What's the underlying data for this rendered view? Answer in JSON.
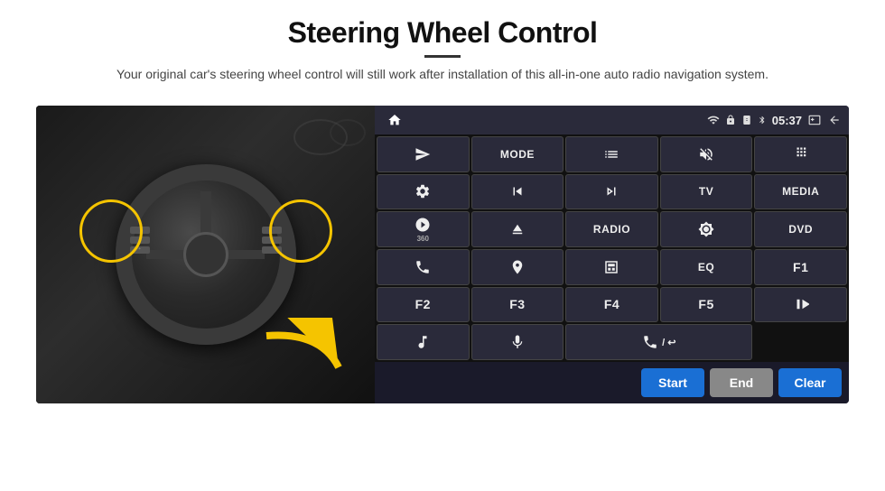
{
  "page": {
    "title": "Steering Wheel Control",
    "subtitle": "Your original car's steering wheel control will still work after installation of this all-in-one auto radio navigation system.",
    "divider": true
  },
  "panel": {
    "status_bar": {
      "time": "05:37",
      "wifi_icon": "wifi",
      "lock_icon": "lock",
      "sim_icon": "sim",
      "bt_icon": "bluetooth",
      "screen_icon": "screen",
      "back_icon": "back"
    },
    "buttons": [
      {
        "id": "b1",
        "type": "icon",
        "icon": "send",
        "label": ""
      },
      {
        "id": "b2",
        "type": "text",
        "label": "MODE"
      },
      {
        "id": "b3",
        "type": "icon",
        "icon": "list",
        "label": ""
      },
      {
        "id": "b4",
        "type": "icon",
        "icon": "mute",
        "label": ""
      },
      {
        "id": "b5",
        "type": "icon",
        "icon": "grid",
        "label": ""
      },
      {
        "id": "b6",
        "type": "icon",
        "icon": "settings",
        "label": ""
      },
      {
        "id": "b7",
        "type": "icon",
        "icon": "rewind",
        "label": ""
      },
      {
        "id": "b8",
        "type": "icon",
        "icon": "fastforward",
        "label": ""
      },
      {
        "id": "b9",
        "type": "text",
        "label": "TV"
      },
      {
        "id": "b10",
        "type": "text",
        "label": "MEDIA"
      },
      {
        "id": "b11",
        "type": "icon",
        "icon": "360cam",
        "label": ""
      },
      {
        "id": "b12",
        "type": "icon",
        "icon": "eject",
        "label": ""
      },
      {
        "id": "b13",
        "type": "text",
        "label": "RADIO"
      },
      {
        "id": "b14",
        "type": "icon",
        "icon": "brightness",
        "label": ""
      },
      {
        "id": "b15",
        "type": "text",
        "label": "DVD"
      },
      {
        "id": "b16",
        "type": "icon",
        "icon": "phone",
        "label": ""
      },
      {
        "id": "b17",
        "type": "icon",
        "icon": "gps",
        "label": ""
      },
      {
        "id": "b18",
        "type": "icon",
        "icon": "window",
        "label": ""
      },
      {
        "id": "b19",
        "type": "text",
        "label": "EQ"
      },
      {
        "id": "b20",
        "type": "text",
        "label": "F1"
      },
      {
        "id": "b21",
        "type": "text",
        "label": "F2"
      },
      {
        "id": "b22",
        "type": "text",
        "label": "F3"
      },
      {
        "id": "b23",
        "type": "text",
        "label": "F4"
      },
      {
        "id": "b24",
        "type": "text",
        "label": "F5"
      },
      {
        "id": "b25",
        "type": "icon",
        "icon": "playpause",
        "label": ""
      },
      {
        "id": "b26",
        "type": "icon",
        "icon": "music",
        "label": ""
      },
      {
        "id": "b27",
        "type": "icon",
        "icon": "mic",
        "label": ""
      },
      {
        "id": "b28",
        "type": "icon",
        "icon": "call",
        "label": ""
      }
    ],
    "action_bar": {
      "start_label": "Start",
      "end_label": "End",
      "clear_label": "Clear"
    }
  }
}
